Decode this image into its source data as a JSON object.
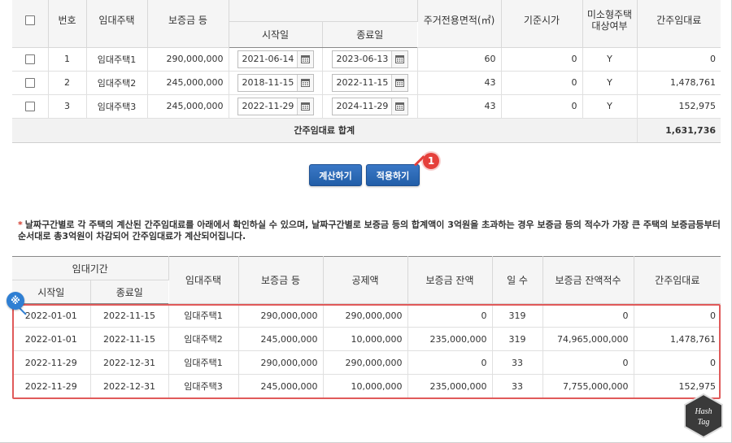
{
  "top_table": {
    "headers": {
      "select": "",
      "no": "번호",
      "house": "임대주택",
      "deposit": "보증금 등",
      "start": "시작일",
      "end": "종료일",
      "area": "주거전용면적(㎡)",
      "std_price": "기준시가",
      "small_housing": "미소형주택 대상여부",
      "deemed_rent": "간주임대료"
    },
    "rows": [
      {
        "no": "1",
        "house": "임대주택1",
        "deposit": "290,000,000",
        "start": "2021-06-14",
        "end": "2023-06-13",
        "area": "60",
        "std_price": "0",
        "small": "Y",
        "deemed": "0"
      },
      {
        "no": "2",
        "house": "임대주택2",
        "deposit": "245,000,000",
        "start": "2018-11-15",
        "end": "2022-11-15",
        "area": "43",
        "std_price": "0",
        "small": "Y",
        "deemed": "1,478,761"
      },
      {
        "no": "3",
        "house": "임대주택3",
        "deposit": "245,000,000",
        "start": "2022-11-29",
        "end": "2024-11-29",
        "area": "43",
        "std_price": "0",
        "small": "Y",
        "deemed": "152,975"
      }
    ],
    "sum_label": "간주임대료 합계",
    "sum_value": "1,631,736"
  },
  "buttons": {
    "calc": "계산하기",
    "apply": "적용하기",
    "apply_badge": "1"
  },
  "notice": {
    "star": "*",
    "text": "날짜구간별로 각 주택의 계산된 간주임대료를 아래에서 확인하실 수 있으며, 날짜구간별로 보증금 등의 합계액이 3억원을 초과하는 경우 보증금 등의 적수가 가장 큰 주택의 보증금등부터 순서대로 총3억원이 차감되어 간주임대료가 계산되어집니다."
  },
  "bottom_table": {
    "headers": {
      "period": "임대기간",
      "start": "시작일",
      "end": "종료일",
      "house": "임대주택",
      "deposit": "보증금 등",
      "deduction": "공제액",
      "balance": "보증금 잔액",
      "days": "일 수",
      "balance_product": "보증금 잔액적수",
      "deemed_rent": "간주임대료"
    },
    "rows": [
      {
        "start": "2022-01-01",
        "end": "2022-11-15",
        "house": "임대주택1",
        "deposit": "290,000,000",
        "deduction": "290,000,000",
        "balance": "0",
        "days": "319",
        "product": "0",
        "deemed": "0"
      },
      {
        "start": "2022-01-01",
        "end": "2022-11-15",
        "house": "임대주택2",
        "deposit": "245,000,000",
        "deduction": "10,000,000",
        "balance": "235,000,000",
        "days": "319",
        "product": "74,965,000,000",
        "deemed": "1,478,761"
      },
      {
        "start": "2022-11-29",
        "end": "2022-12-31",
        "house": "임대주택1",
        "deposit": "290,000,000",
        "deduction": "290,000,000",
        "balance": "0",
        "days": "33",
        "product": "0",
        "deemed": "0"
      },
      {
        "start": "2022-11-29",
        "end": "2022-12-31",
        "house": "임대주택3",
        "deposit": "245,000,000",
        "deduction": "10,000,000",
        "balance": "235,000,000",
        "days": "33",
        "product": "7,755,000,000",
        "deemed": "152,975"
      }
    ]
  },
  "note_badge": "※",
  "watermark": {
    "line1": "Hash",
    "line2": "Tag"
  },
  "colors": {
    "button": "#2c6cb8",
    "badge_red": "#e5403b",
    "highlight": "#e05a5a",
    "note_blue": "#2f7fd3"
  },
  "icons": {
    "calendar": "calendar-icon",
    "checkbox": "checkbox"
  }
}
